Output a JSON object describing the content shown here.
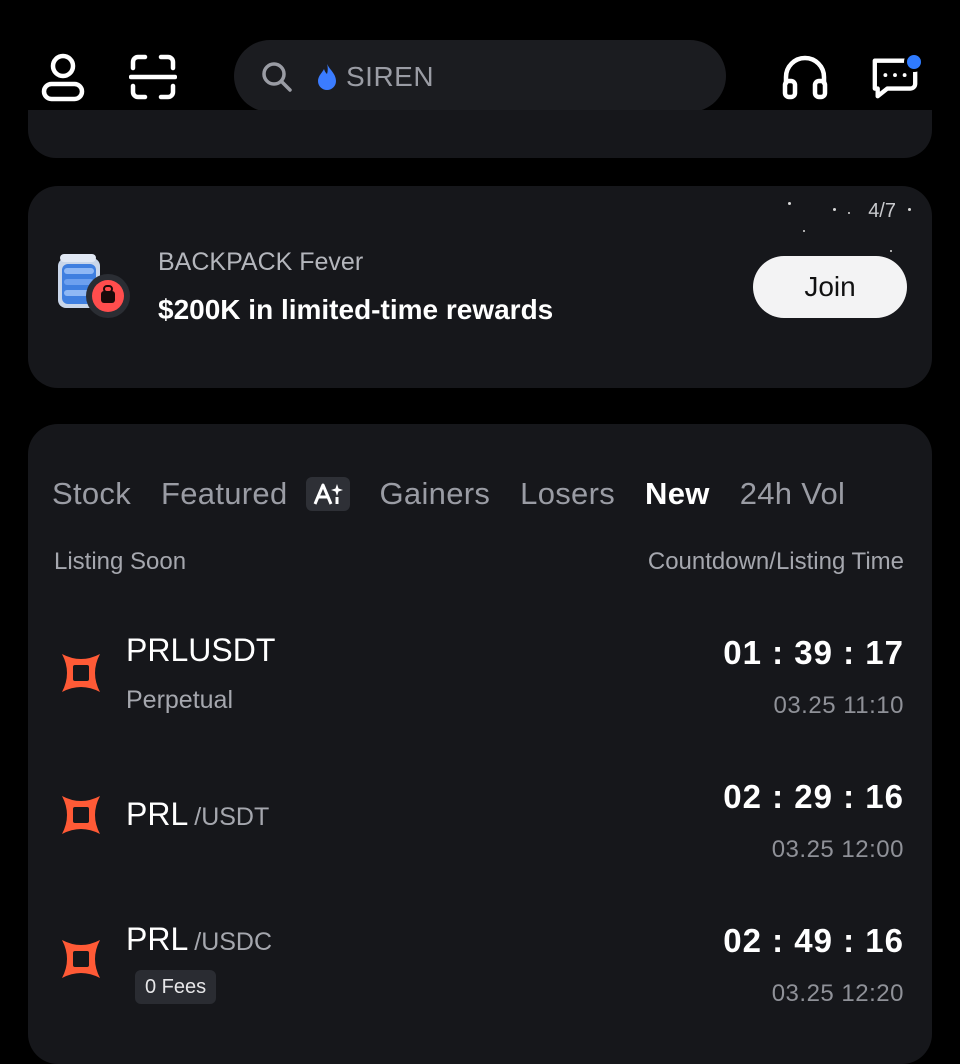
{
  "header": {
    "search_text": "SIREN"
  },
  "promo": {
    "counter": "4/7",
    "subtitle": "BACKPACK Fever",
    "title": "$200K in limited-time rewards",
    "join_label": "Join"
  },
  "market": {
    "tabs": [
      "Stock",
      "Featured",
      "Gainers",
      "Losers",
      "New",
      "24h Vol"
    ],
    "active_tab": "New",
    "col_left": "Listing Soon",
    "col_right": "Countdown/Listing Time",
    "rows": [
      {
        "symbol": "PRLUSDT",
        "quote": "",
        "subtitle": "Perpetual",
        "badge": "",
        "countdown": "01 : 39 : 17",
        "listing_time": "03.25 11:10"
      },
      {
        "symbol": "PRL",
        "quote": "/USDT",
        "subtitle": "",
        "badge": "",
        "countdown": "02 : 29 : 16",
        "listing_time": "03.25 12:00"
      },
      {
        "symbol": "PRL",
        "quote": "/USDC",
        "subtitle": "",
        "badge": "0 Fees",
        "countdown": "02 : 49 : 16",
        "listing_time": "03.25 12:20"
      }
    ]
  },
  "colors": {
    "background": "#000000",
    "card": "#16171b",
    "accent_blue": "#2f7bff",
    "logo_orange": "#ff5a36"
  }
}
